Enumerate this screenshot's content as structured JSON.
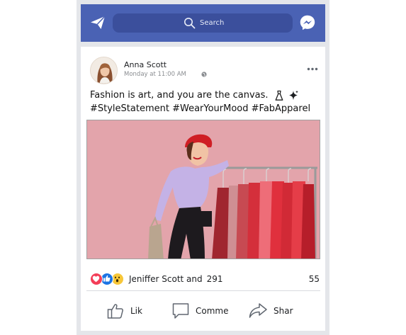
{
  "topbar": {
    "search_placeholder": "Search",
    "left_icon": "paper-plane-icon",
    "right_icon": "messenger-icon",
    "accent": "#4a62b4"
  },
  "post": {
    "author": "Anna Scott",
    "timestamp": "Monday at 11:00 AM",
    "privacy_icon": "globe-icon",
    "text_line1": "Fashion is art, and you are the canvas.",
    "text_line1_emojis": [
      "dress-icon",
      "sparkles-icon"
    ],
    "text_line2": "#StyleStatement #WearYourMood #FabApparel",
    "image": "woman-in-red-beret-with-clothing-rack-photo"
  },
  "engagement": {
    "reaction_icons": [
      "love-reaction-icon",
      "like-reaction-icon",
      "wow-reaction-icon"
    ],
    "reactors": "Jeniffer Scott and",
    "reaction_count": "291",
    "comment_count": "55"
  },
  "actions": {
    "like": "Lik",
    "comment": "Comme",
    "share": "Shar"
  }
}
